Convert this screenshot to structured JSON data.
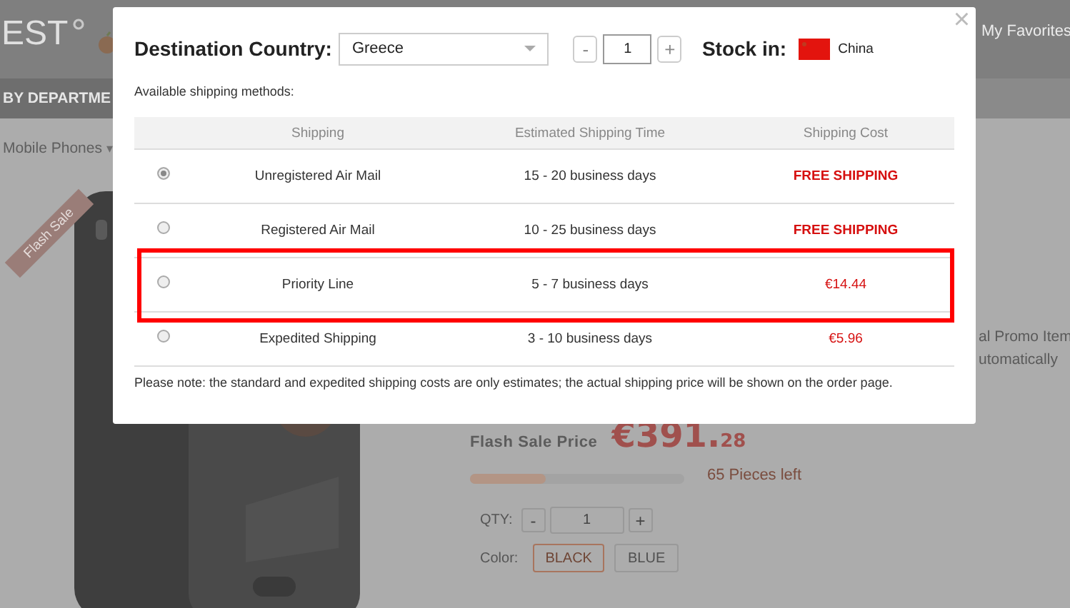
{
  "header": {
    "logo": "EST",
    "favorites": "My Favorites",
    "department": "BY DEPARTME"
  },
  "breadcrumb": {
    "label": "Mobile Phones",
    "caret": "▾"
  },
  "product": {
    "ribbon": "Flash Sale",
    "image": {
      "kind": "picture"
    },
    "promo_lines": [
      "al Promo Item",
      "utomatically"
    ],
    "price_label": "Flash Sale Price",
    "price_main": "€391.",
    "price_cents": "28",
    "stock": {
      "level": 0.35,
      "text": "65 Pieces left"
    },
    "qty_label": "QTY:",
    "qty": "1",
    "qty_minus": "-",
    "qty_plus": "+",
    "color_label": "Color:",
    "colors": [
      {
        "label": "BLACK",
        "selected": true
      },
      {
        "label": "BLUE",
        "selected": false
      }
    ]
  },
  "dialog": {
    "close": "×",
    "destination_label": "Destination Country:",
    "destination": "Greece",
    "qty_minus": "-",
    "qty": "1",
    "qty_plus": "+",
    "stock_label": "Stock in:",
    "stock_country": "China",
    "methods_label": "Available shipping methods:",
    "columns": [
      "Shipping",
      "Estimated Shipping Time",
      "Shipping Cost"
    ],
    "rows": [
      {
        "selected": true,
        "highlighted": false,
        "shipping": "Unregistered Air Mail",
        "time": "15 - 20 business days",
        "cost": "FREE SHIPPING",
        "kind": "free"
      },
      {
        "selected": false,
        "highlighted": false,
        "shipping": "Registered Air Mail",
        "time": "10 - 25 business days",
        "cost": "FREE SHIPPING",
        "kind": "free"
      },
      {
        "selected": false,
        "highlighted": true,
        "shipping": "Priority Line",
        "time": "5 - 7 business days",
        "cost": "€14.44",
        "kind": "price"
      },
      {
        "selected": false,
        "highlighted": false,
        "shipping": "Expedited Shipping",
        "time": "3 - 10 business days",
        "cost": "€5.96",
        "kind": "price"
      }
    ],
    "note": "Please note: the standard and expedited shipping costs are only estimates; the actual shipping price will be shown on the order page."
  }
}
